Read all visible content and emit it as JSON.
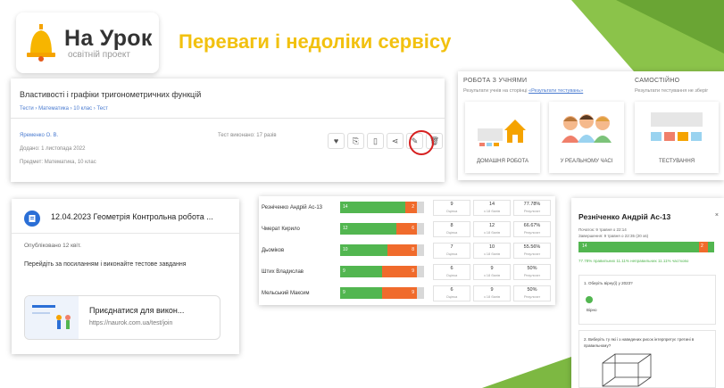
{
  "logo": {
    "main": "На Урок",
    "sub": "освітній проект"
  },
  "slide_title": "Переваги і недоліки сервісу",
  "test_card": {
    "title": "Властивості і графіки тригонометричних функцій",
    "breadcrumbs": "Тести › Математика › 10 клас › Тест",
    "author": "Яременко О. В.",
    "added": "Додано: 1 листопада 2022",
    "subject": "Предмет: Математика, 10 клас",
    "completed": "Тест виконано: 17 разів"
  },
  "work_card": {
    "section1_title": "РОБОТА З УЧНЯМИ",
    "section1_sub_before": "Результати учнів на сторінці",
    "section1_sub_link": "«Результати тестувань»",
    "section2_title": "САМОСТІЙНО",
    "section2_sub": "Результати тестування не зберіг",
    "tiles": [
      "ДОМАШНЯ РОБОТА",
      "У РЕАЛЬНОМУ ЧАСІ",
      "ТЕСТУВАННЯ"
    ]
  },
  "classroom_card": {
    "title": "12.04.2023 Геометрія Контрольна робота ...",
    "published": "Опубліковано 12 квіт.",
    "body": "Перейдіть за посиланням і виконайте тестове завдання",
    "attach_title": "Приєднатися для викон...",
    "attach_url": "https://naurok.com.ua/test/join"
  },
  "results": [
    {
      "name": "Резніченко Андрій Ас-13",
      "green": "14",
      "orange": "2",
      "score": "9",
      "score_label": "Оцінка",
      "mark": "14",
      "mark_label": "з 18 балів",
      "pct": "77.78%",
      "pct_label": "Результат"
    },
    {
      "name": "Чмерат Кирило",
      "green": "12",
      "orange": "6",
      "score": "8",
      "score_label": "Оцінка",
      "mark": "12",
      "mark_label": "з 18 балів",
      "pct": "66.67%",
      "pct_label": "Результат"
    },
    {
      "name": "Дьоміков",
      "green": "10",
      "orange": "8",
      "score": "7",
      "score_label": "Оцінка",
      "mark": "10",
      "mark_label": "з 18 балів",
      "pct": "55.56%",
      "pct_label": "Результат"
    },
    {
      "name": "Штих Владислав",
      "green": "9",
      "orange": "9",
      "score": "6",
      "score_label": "Оцінка",
      "mark": "9",
      "mark_label": "з 18 балів",
      "pct": "50%",
      "pct_label": "Результат"
    },
    {
      "name": "Мельський Максим",
      "green": "9",
      "orange": "9",
      "score": "6",
      "score_label": "Оцінка",
      "mark": "9",
      "mark_label": "з 18 балів",
      "pct": "50%",
      "pct_label": "Результат"
    }
  ],
  "student_card": {
    "name": "Резніченко Андрій Ас-13",
    "close": "×",
    "line1": "Початок: 9 травня о 22:14",
    "line2": "Завершення: 9 травня о 22:35 (20 хв)",
    "bar_green": "14",
    "bar_orange": "2",
    "legend": "77.78% правильних   11.11% неправильних   11.11% частково",
    "q1": "1. Оберіть вірну(і) у 2023?",
    "q1_answer": "Вірно",
    "q2": "2. Виберіть ту які і з наведених рисок інтерпретує третині в правильному?"
  }
}
